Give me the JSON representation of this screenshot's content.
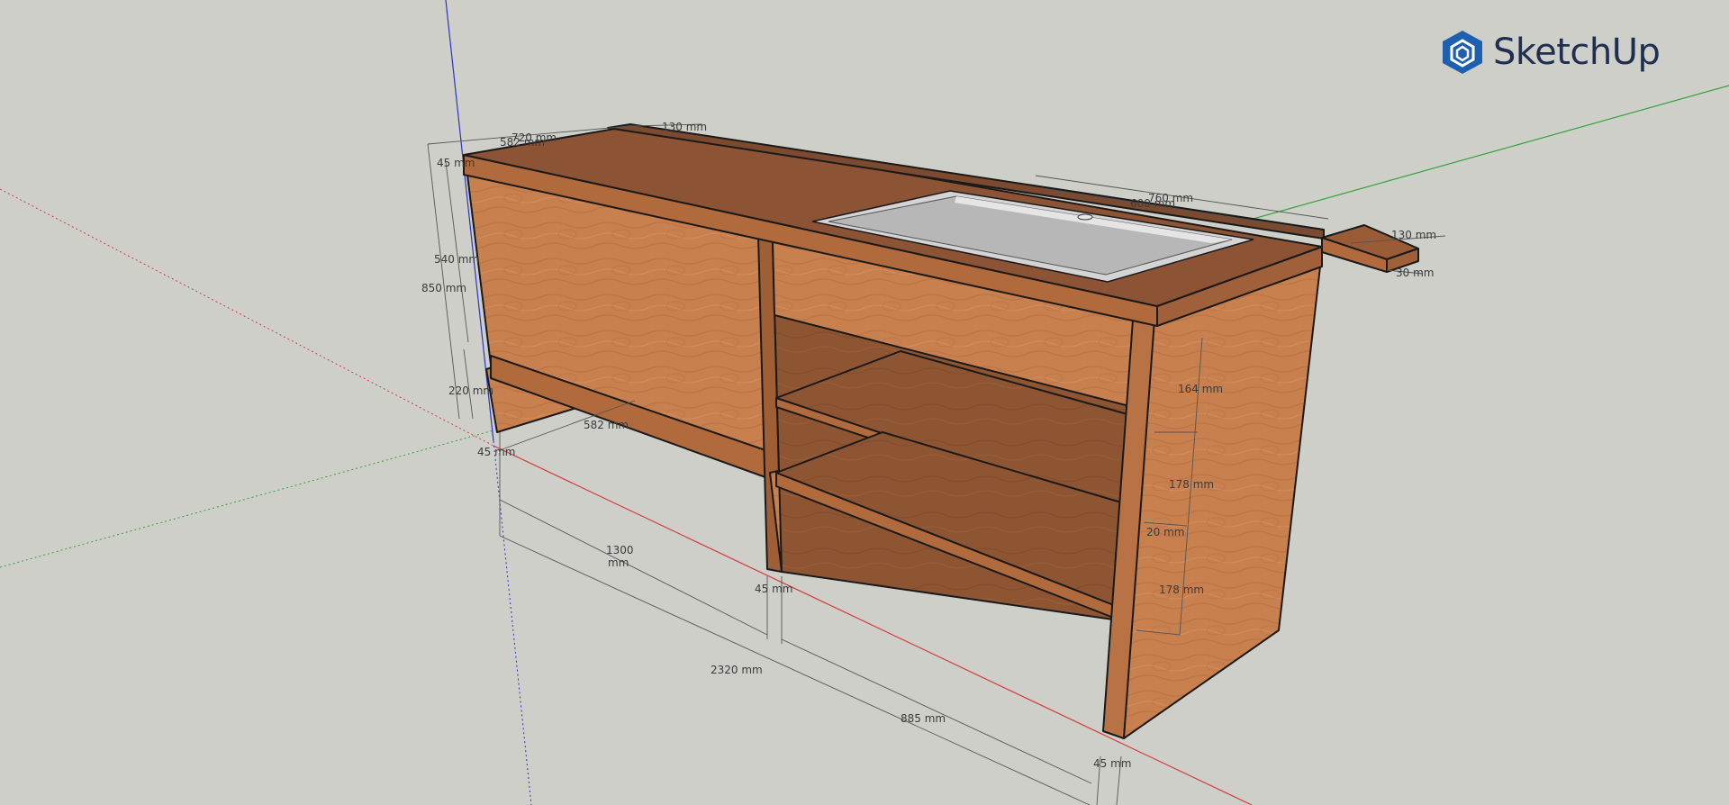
{
  "app": {
    "logo_text": "SketchUp",
    "logo_icon": "sketchup-logo-icon"
  },
  "colors": {
    "background": "#cfcfca",
    "wood_light": "#c8804f",
    "wood_mid": "#b06a3c",
    "wood_dark": "#8a5030",
    "sink": "#b9b9b9",
    "axis_red": "#d23c3c",
    "axis_green": "#33a33a",
    "axis_blue": "#2a35c8",
    "logo_blue": "#1f5fb0"
  },
  "dimensions": {
    "d720": "720 mm",
    "d582_top": "582 mm",
    "d130_top": "130 mm",
    "d45_top": "45 mm",
    "d540": "540 mm",
    "d850": "850 mm",
    "d220": "220 mm",
    "d582": "582 mm",
    "d45_left": "45 mm",
    "d1300_a": "1300",
    "d1300_b": "mm",
    "d2320": "2320 mm",
    "d45_mid": "45 mm",
    "d885": "885 mm",
    "d45_bottom": "45 mm",
    "d760": "760 mm",
    "d600": "600 mm",
    "d130_right": "130 mm",
    "d30": "30 mm",
    "d164": "164 mm",
    "d178_a": "178 mm",
    "d20": "20 mm",
    "d178_b": "178 mm"
  }
}
